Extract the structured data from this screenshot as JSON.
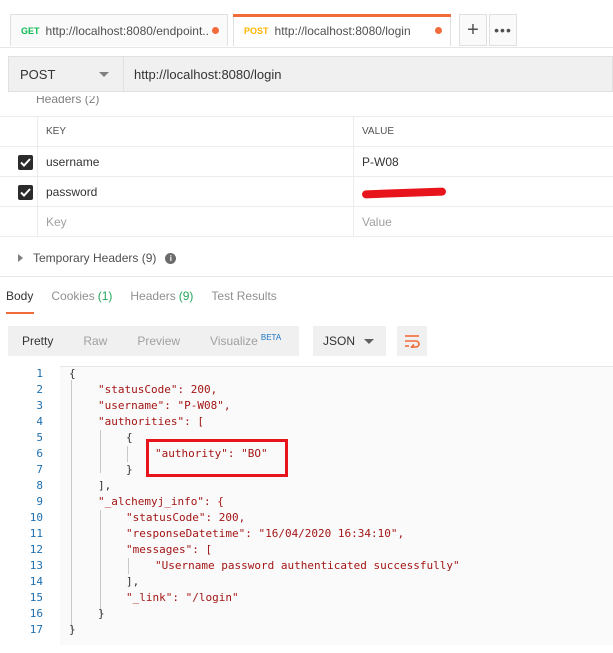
{
  "tabs": [
    {
      "method": "GET",
      "url": "http://localhost:8080/endpoint...",
      "active": false
    },
    {
      "method": "POST",
      "url": "http://localhost:8080/login",
      "active": true
    }
  ],
  "tab_actions": {
    "plus": "+",
    "more": "•••"
  },
  "request": {
    "method": "POST",
    "url": "http://localhost:8080/login"
  },
  "headers_section": {
    "label_partial": "Headers (2)"
  },
  "headers_table": {
    "col_key": "KEY",
    "col_value": "VALUE",
    "rows": [
      {
        "key": "username",
        "value": "P-W08",
        "checked": true
      },
      {
        "key": "password",
        "value": "",
        "checked": true,
        "redacted": true
      }
    ],
    "placeholder_key": "Key",
    "placeholder_value": "Value"
  },
  "temporary_headers": {
    "label": "Temporary Headers",
    "count": "(9)"
  },
  "response_tabs": [
    {
      "label": "Body",
      "count": "",
      "active": true
    },
    {
      "label": "Cookies",
      "count": "(1)",
      "active": false
    },
    {
      "label": "Headers",
      "count": "(9)",
      "active": false
    },
    {
      "label": "Test Results",
      "count": "",
      "active": false
    }
  ],
  "view_modes": [
    {
      "label": "Pretty",
      "active": true
    },
    {
      "label": "Raw",
      "active": false
    },
    {
      "label": "Preview",
      "active": false
    },
    {
      "label": "Visualize",
      "badge": "BETA",
      "active": false
    }
  ],
  "format": "JSON",
  "code_lines": [
    "{",
    "\"statusCode\": 200,",
    "\"username\": \"P-W08\",",
    "\"authorities\": [",
    "{",
    "\"authority\": \"BO\"",
    "}",
    "],",
    "\"_alchemyj_info\": {",
    "\"statusCode\": 200,",
    "\"responseDatetime\": \"16/04/2020 16:34:10\",",
    "\"messages\": [",
    "\"Username password authenticated successfully\"",
    "],",
    "\"_link\": \"/login\"",
    "}",
    "}"
  ],
  "colors": {
    "accent": "#f26b3a",
    "get": "#0cbb52",
    "post": "#ffb400",
    "highlight": "#e8141c"
  }
}
